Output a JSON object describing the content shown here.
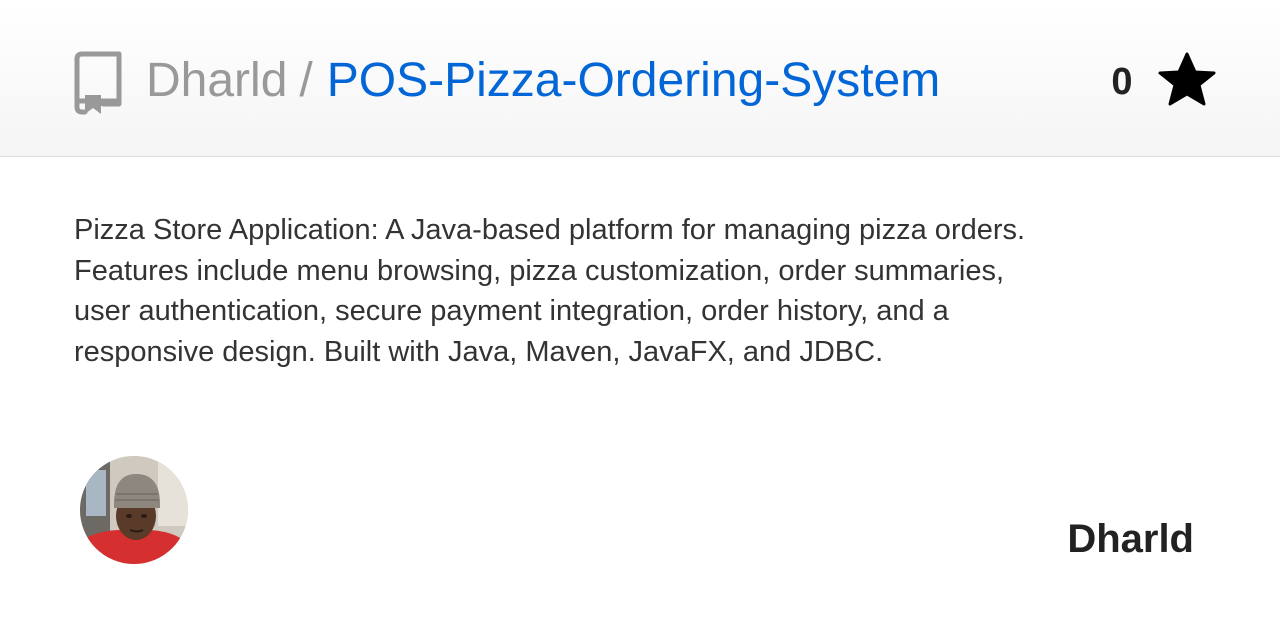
{
  "header": {
    "owner": "Dharld",
    "separator": "/",
    "repo_name": "POS-Pizza-Ordering-System",
    "repo_icon": "repo-book-icon",
    "star_count": "0",
    "star_icon": "star-icon"
  },
  "description": "Pizza Store Application: A Java-based platform for managing pizza orders. Features include menu browsing, pizza customization, order summaries, user authentication, secure payment integration, order history, and a responsive design. Built with Java, Maven, JavaFX, and JDBC.",
  "author": {
    "name": "Dharld",
    "avatar": "user-avatar"
  },
  "colors": {
    "link": "#0366d6",
    "muted": "#999999",
    "text": "#333333",
    "strong": "#222222",
    "header_border": "#dddddd"
  }
}
